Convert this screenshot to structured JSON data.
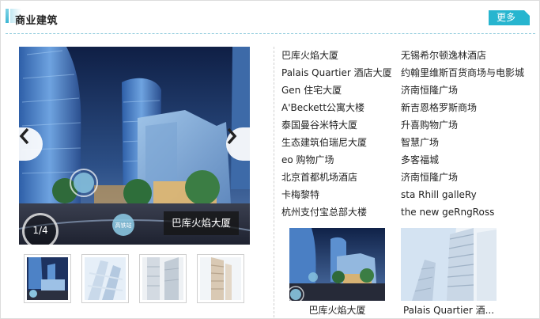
{
  "section": {
    "title": "商业建筑",
    "more_label": "更多"
  },
  "slideshow": {
    "counter": "1/4",
    "caption": "巴库火焰大厦",
    "badge_text": "高铁站",
    "prev_icon": "chevron-left-icon",
    "next_icon": "chevron-right-icon"
  },
  "list_left": [
    "巴库火焰大厦",
    "Palais Quartier 酒店大厦",
    "Gen 住宅大厦",
    "A'Beckett公寓大楼",
    "泰国曼谷米特大厦",
    "生态建筑伯瑞尼大厦",
    "eo 购物广场",
    "北京首都机场酒店",
    "卡梅黎特",
    "杭州支付宝总部大楼"
  ],
  "list_right": [
    "无锡希尔顿逸林酒店",
    "约翰里维斯百货商场与电影城",
    "济南恒隆广场",
    "新吉恩格罗斯商场",
    "升喜购物广场",
    "智慧广场",
    "多客福城",
    "济南恒隆广场",
    "sta Rhill galleRy",
    "the new geRngRoss"
  ],
  "cards": [
    {
      "caption": "巴库火焰大厦"
    },
    {
      "caption": "Palais Quartier 酒..."
    }
  ],
  "colors": {
    "accent": "#27b5cf",
    "text": "#222222",
    "divider": "#8fcbdc"
  }
}
